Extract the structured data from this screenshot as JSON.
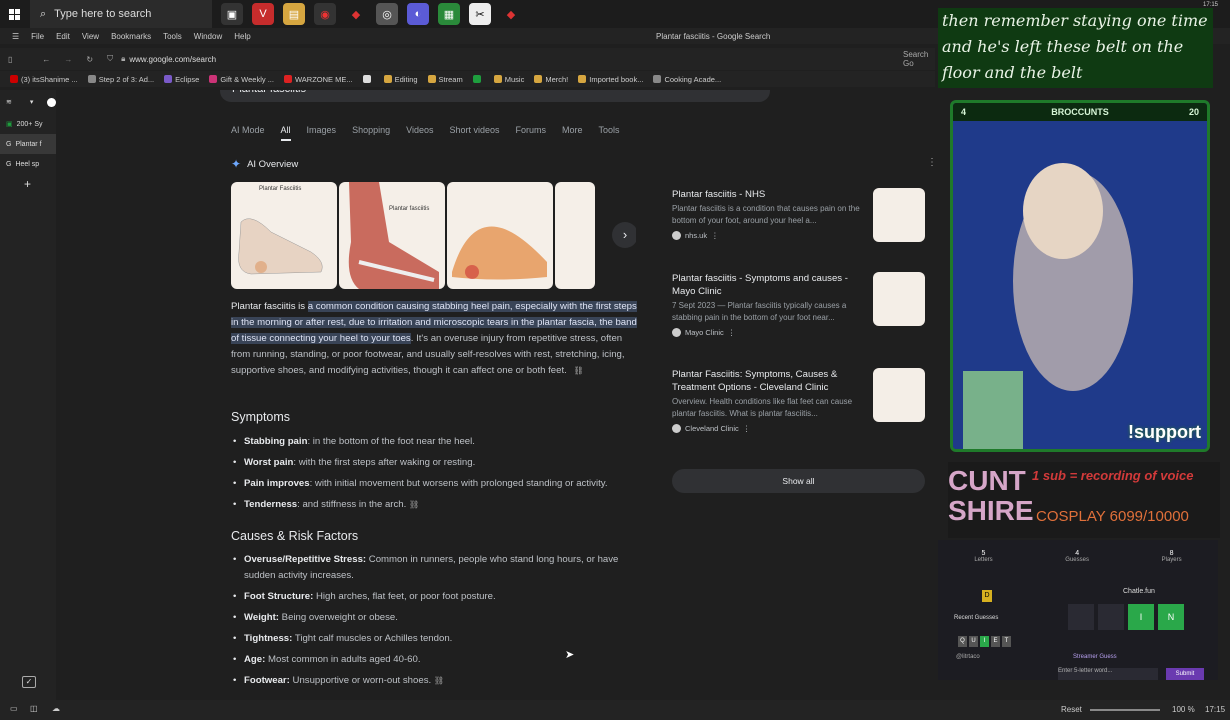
{
  "taskbar": {
    "search_placeholder": "Type here to search",
    "clock": "17:15"
  },
  "menubar": [
    "File",
    "Edit",
    "View",
    "Bookmarks",
    "Tools",
    "Window",
    "Help"
  ],
  "window_title": "Plantar fasciitis - Google Search",
  "address": "www.google.com/search",
  "address_search_label": "Search Go",
  "bookmarks": [
    {
      "label": "(3) itsShanime ...",
      "color": "#cc0000"
    },
    {
      "label": "Step 2 of 3: Ad...",
      "color": "#888888"
    },
    {
      "label": "Eclipse",
      "color": "#7a5ac9"
    },
    {
      "label": "Gift & Weekly ...",
      "color": "#cc3377"
    },
    {
      "label": "WARZONE ME...",
      "color": "#dd2222"
    },
    {
      "label": "",
      "color": "#dddddd"
    },
    {
      "label": "Editing",
      "color": "#d6a640"
    },
    {
      "label": "Stream",
      "color": "#d6a640"
    },
    {
      "label": "",
      "color": "#1e9e3e"
    },
    {
      "label": "Music",
      "color": "#d6a640"
    },
    {
      "label": "Merch!",
      "color": "#d6a640"
    },
    {
      "label": "Imported book...",
      "color": "#d6a640"
    },
    {
      "label": "Cooking Acade...",
      "color": "#888888"
    }
  ],
  "sidepanel": {
    "tabs": [
      "200+ Sy",
      "Plantar f",
      "Heel sp"
    ]
  },
  "search_query": "Plantar fasciitis",
  "nav_tabs": [
    "AI Mode",
    "All",
    "Images",
    "Shopping",
    "Videos",
    "Short videos",
    "Forums",
    "More",
    "Tools"
  ],
  "ai_overview_title": "AI Overview",
  "images": [
    {
      "caption": "Plantar Fasciitis"
    },
    {
      "caption": "Plantar fasciitis"
    },
    {
      "caption": ""
    },
    {
      "caption": ""
    }
  ],
  "overview": {
    "lead": "Plantar fasciitis is ",
    "highlight": "a common condition causing stabbing heel pain, especially with the first steps in the morning or after rest, due to irritation and microscopic tears in the plantar fascia, the band of tissue connecting your heel to your toes",
    "rest": ". It's an overuse injury from repetitive stress, often from running, standing, or poor footwear, and usually self-resolves with rest, stretching, icing, supportive shoes, and modifying activities, though it can affect one or both feet."
  },
  "symptoms": {
    "heading": "Symptoms",
    "items": [
      {
        "b": "Stabbing pain",
        "t": ": in the bottom of the foot near the heel."
      },
      {
        "b": "Worst pain",
        "t": ": with the first steps after waking or resting."
      },
      {
        "b": "Pain improves",
        "t": ": with initial movement but worsens with prolonged standing or activity."
      },
      {
        "b": "Tenderness",
        "t": ": and stiffness in the arch."
      }
    ]
  },
  "causes": {
    "heading": "Causes & Risk Factors",
    "items": [
      {
        "b": "Overuse/Repetitive Stress:",
        "t": " Common in runners, people who stand long hours, or have sudden activity increases."
      },
      {
        "b": "Foot Structure:",
        "t": " High arches, flat feet, or poor foot posture."
      },
      {
        "b": "Weight:",
        "t": " Being overweight or obese."
      },
      {
        "b": "Tightness:",
        "t": " Tight calf muscles or Achilles tendon."
      },
      {
        "b": "Age:",
        "t": " Most common in adults aged 40-60."
      },
      {
        "b": "Footwear:",
        "t": " Unsupportive or worn-out shoes."
      }
    ]
  },
  "sources": [
    {
      "title": "Plantar fasciitis - NHS",
      "desc": "Plantar fasciitis is a condition that causes pain on the bottom of your foot, around your heel a...",
      "site": "nhs.uk"
    },
    {
      "title": "Plantar fasciitis - Symptoms and causes - Mayo Clinic",
      "desc": "7 Sept 2023 — Plantar fasciitis typically causes a stabbing pain in the bottom of your foot near...",
      "site": "Mayo Clinic"
    },
    {
      "title": "Plantar Fasciitis: Symptoms, Causes & Treatment Options - Cleveland Clinic",
      "desc": "Overview. Health conditions like flat feet can cause plantar fasciitis. What is plantar fasciitis...",
      "site": "Cleveland Clinic"
    }
  ],
  "show_all": "Show all",
  "stream": {
    "caption": "then remember staying one time and he's left these belt on the floor and the belt",
    "webcam_left": "4",
    "webcam_name": "BROCCUNTS",
    "webcam_right": "20",
    "support": "!support",
    "banner_big": "CUNT SHIRE",
    "banner_sub": "1 sub = recording of voice",
    "cosplay": "COSPLAY 6099/10000",
    "game": {
      "stats": [
        {
          "n": "5",
          "l": "Letters"
        },
        {
          "n": "4",
          "l": "Guesses"
        },
        {
          "n": "8",
          "l": "Players"
        }
      ],
      "tile": "D",
      "recent": "Recent Guesses",
      "word": [
        "Q",
        "U",
        "I",
        "E",
        "T"
      ],
      "user": "@litrtaco",
      "brand": "Chatle.fun",
      "board": [
        "",
        "",
        "I",
        "N"
      ],
      "streamer_guess": "Streamer Guess",
      "input_placeholder": "Enter 5-letter word...",
      "submit": "Submit"
    }
  },
  "status": {
    "reset": "Reset",
    "zoom": "100 %",
    "time": "17:15"
  }
}
